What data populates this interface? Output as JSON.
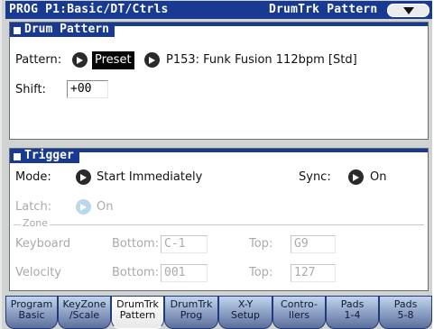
{
  "header": {
    "title": "PROG P1:Basic/DT/Ctrls",
    "page": "DrumTrk Pattern",
    "menu_icon": "chevron-down-icon"
  },
  "drum_pattern": {
    "section_title": "Drum Pattern",
    "pattern_label": "Pattern:",
    "pattern_bank": "Preset",
    "pattern_name": "P153: Funk Fusion 112bpm [Std]",
    "shift_label": "Shift:",
    "shift_value": "+00"
  },
  "trigger": {
    "section_title": "Trigger",
    "mode_label": "Mode:",
    "mode_value": "Start Immediately",
    "sync_label": "Sync:",
    "sync_value": "On",
    "latch_label": "Latch:",
    "latch_value": "On",
    "zone_label": "Zone",
    "keyboard_label": "Keyboard",
    "keyboard_bottom_label": "Bottom:",
    "keyboard_bottom_value": "C-1",
    "keyboard_top_label": "Top:",
    "keyboard_top_value": "G9",
    "velocity_label": "Velocity",
    "velocity_bottom_label": "Bottom:",
    "velocity_bottom_value": "001",
    "velocity_top_label": "Top:",
    "velocity_top_value": "127"
  },
  "tabs": [
    {
      "line1": "Program",
      "line2": "Basic"
    },
    {
      "line1": "KeyZone",
      "line2": "/Scale"
    },
    {
      "line1": "DrumTrk",
      "line2": "Pattern"
    },
    {
      "line1": "DrumTrk",
      "line2": "Prog"
    },
    {
      "line1": "X-Y",
      "line2": "Setup"
    },
    {
      "line1": "Contro-",
      "line2": "llers"
    },
    {
      "line1": "Pads",
      "line2": "1-4"
    },
    {
      "line1": "Pads",
      "line2": "5-8"
    }
  ],
  "active_tab": 2,
  "colors": {
    "header_bg": "#183a92",
    "panel_bg": "#ffffff",
    "screen_bg": "#cfd3d2",
    "tab_gradient_top": "#c0d4ef",
    "tab_gradient_bottom": "#5c6f9c",
    "disabled_arrow": "#b9d8ee"
  }
}
